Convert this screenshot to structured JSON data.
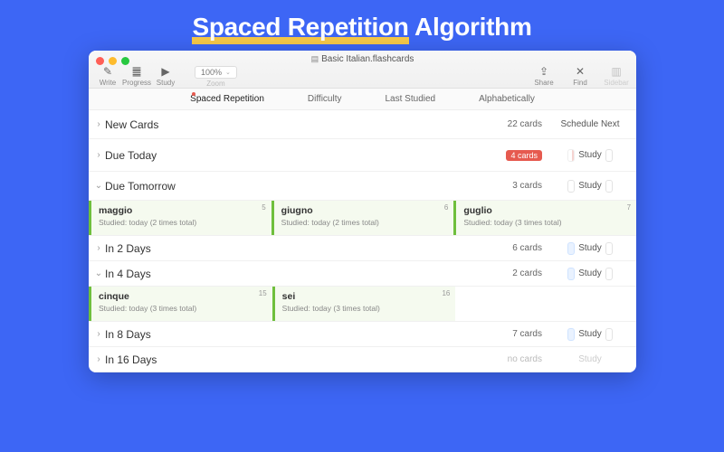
{
  "hero": {
    "underlined": "Spaced Repetition",
    "rest": " Algorithm"
  },
  "window_title": "Basic Italian.flashcards",
  "toolbar": {
    "write": "Write",
    "progress": "Progress",
    "study": "Study",
    "zoom_value": "100%",
    "zoom_label": "Zoom",
    "share": "Share",
    "find": "Find",
    "sidebar": "Sidebar"
  },
  "tabs": {
    "spaced": "Spaced Repetition",
    "difficulty": "Difficulty",
    "last": "Last Studied",
    "alpha": "Alphabetically"
  },
  "sections": {
    "new_cards": {
      "label": "New Cards",
      "count": "22 cards",
      "action": "Schedule Next"
    },
    "due_today": {
      "label": "Due Today",
      "badge": "4 cards",
      "action": "Study"
    },
    "due_tomorrow": {
      "label": "Due Tomorrow",
      "count": "3 cards",
      "action": "Study"
    },
    "in_2": {
      "label": "In 2 Days",
      "count": "6 cards",
      "action": "Study"
    },
    "in_4": {
      "label": "In 4 Days",
      "count": "2 cards",
      "action": "Study"
    },
    "in_8": {
      "label": "In 8 Days",
      "count": "7 cards",
      "action": "Study"
    },
    "in_16": {
      "label": "In 16 Days",
      "count": "no cards",
      "action": "Study"
    }
  },
  "cards_tomorrow": [
    {
      "num": "5",
      "word": "maggio",
      "meta": "Studied: today (2 times total)"
    },
    {
      "num": "6",
      "word": "giugno",
      "meta": "Studied: today (2 times total)"
    },
    {
      "num": "7",
      "word": "guglio",
      "meta": "Studied: today (3 times total)"
    }
  ],
  "cards_in4": [
    {
      "num": "15",
      "word": "cinque",
      "meta": "Studied: today (3 times total)"
    },
    {
      "num": "16",
      "word": "sei",
      "meta": "Studied: today (3 times total)"
    }
  ]
}
